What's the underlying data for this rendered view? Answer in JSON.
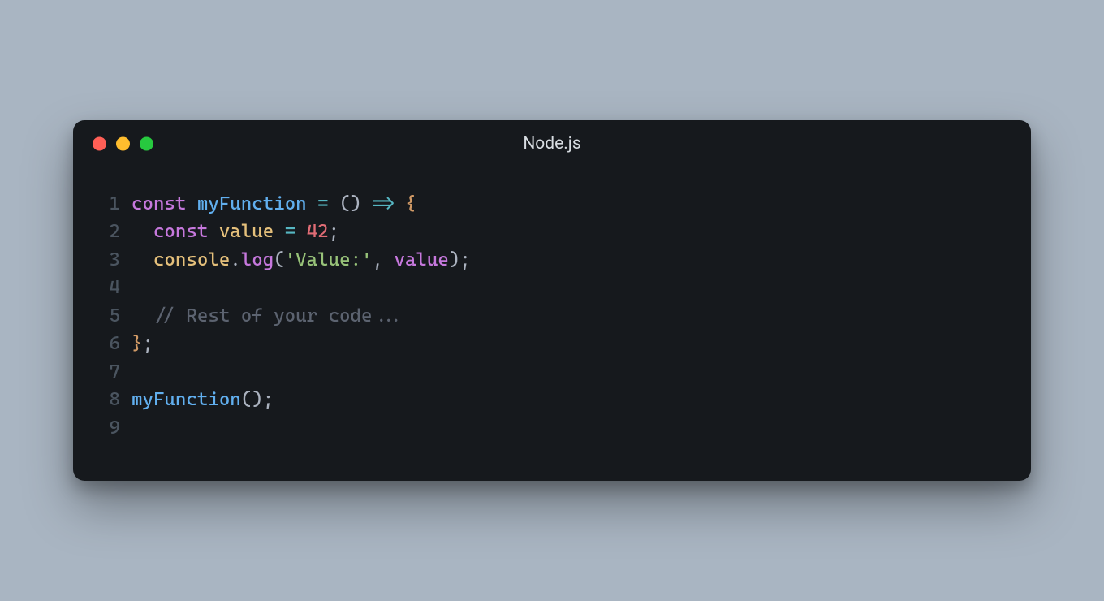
{
  "window": {
    "title": "Node.js",
    "traffic_lights": [
      "close",
      "minimize",
      "zoom"
    ]
  },
  "editor": {
    "language": "javascript",
    "lines": [
      {
        "n": "1",
        "tokens": [
          {
            "t": "const",
            "c": "tk-kw"
          },
          {
            "t": " ",
            "c": ""
          },
          {
            "t": "myFunction",
            "c": "tk-fn"
          },
          {
            "t": " ",
            "c": ""
          },
          {
            "t": "=",
            "c": "tk-op"
          },
          {
            "t": " ",
            "c": ""
          },
          {
            "t": "()",
            "c": "tk-punc"
          },
          {
            "t": " ",
            "c": ""
          },
          {
            "t": "=>",
            "c": "tk-op"
          },
          {
            "t": " ",
            "c": ""
          },
          {
            "t": "{",
            "c": "tk-brace"
          }
        ]
      },
      {
        "n": "2",
        "tokens": [
          {
            "t": "  ",
            "c": ""
          },
          {
            "t": "const",
            "c": "tk-kw"
          },
          {
            "t": " ",
            "c": ""
          },
          {
            "t": "value",
            "c": "tk-var"
          },
          {
            "t": " ",
            "c": ""
          },
          {
            "t": "=",
            "c": "tk-op"
          },
          {
            "t": " ",
            "c": ""
          },
          {
            "t": "42",
            "c": "tk-num"
          },
          {
            "t": ";",
            "c": "tk-punc"
          }
        ]
      },
      {
        "n": "3",
        "tokens": [
          {
            "t": "  ",
            "c": ""
          },
          {
            "t": "console",
            "c": "tk-obj"
          },
          {
            "t": ".",
            "c": "tk-punc"
          },
          {
            "t": "log",
            "c": "tk-method"
          },
          {
            "t": "(",
            "c": "tk-punc"
          },
          {
            "t": "'Value:'",
            "c": "tk-str"
          },
          {
            "t": ",",
            "c": "tk-punc"
          },
          {
            "t": " ",
            "c": ""
          },
          {
            "t": "value",
            "c": "tk-param"
          },
          {
            "t": ")",
            "c": "tk-punc"
          },
          {
            "t": ";",
            "c": "tk-punc"
          }
        ]
      },
      {
        "n": "4",
        "tokens": []
      },
      {
        "n": "5",
        "tokens": [
          {
            "t": "  ",
            "c": ""
          },
          {
            "t": "// Rest of your code...",
            "c": "tk-comm"
          }
        ]
      },
      {
        "n": "6",
        "tokens": [
          {
            "t": "}",
            "c": "tk-brace"
          },
          {
            "t": ";",
            "c": "tk-punc"
          }
        ]
      },
      {
        "n": "7",
        "tokens": []
      },
      {
        "n": "8",
        "tokens": [
          {
            "t": "myFunction",
            "c": "tk-fn"
          },
          {
            "t": "()",
            "c": "tk-punc"
          },
          {
            "t": ";",
            "c": "tk-punc"
          }
        ]
      },
      {
        "n": "9",
        "tokens": []
      }
    ]
  }
}
